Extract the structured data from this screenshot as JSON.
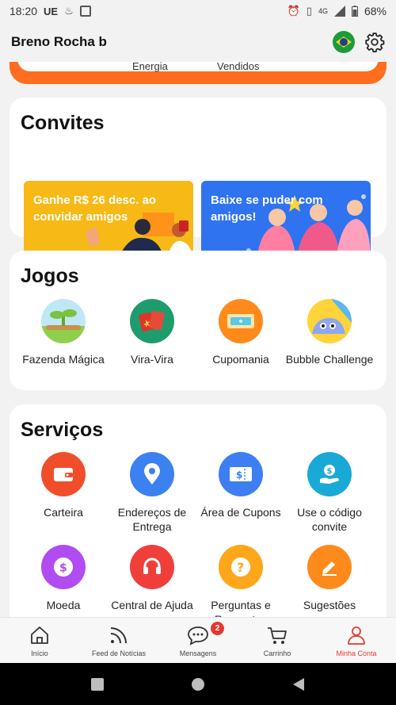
{
  "status_bar": {
    "time": "18:20",
    "carrier": "UE",
    "network": "4G",
    "battery": "68%"
  },
  "header": {
    "user_name": "Breno Rocha b"
  },
  "stats": {
    "labels": [
      "Energia",
      "Vendidos"
    ]
  },
  "invites": {
    "title": "Convites",
    "banners": [
      {
        "text": "Ganhe R$ 26 desc. ao convidar amigos"
      },
      {
        "text": "Baixe se puder com amigos!"
      }
    ]
  },
  "games": {
    "title": "Jogos",
    "items": [
      {
        "label": "Fazenda Mágica",
        "icon": "farm-icon"
      },
      {
        "label": "Vira-Vira",
        "icon": "cards-icon"
      },
      {
        "label": "Cupomania",
        "icon": "coupon-ticket-icon"
      },
      {
        "label": "Bubble Challenge",
        "icon": "bubble-icon"
      }
    ]
  },
  "services": {
    "title": "Serviços",
    "items": [
      {
        "label": "Carteira",
        "icon": "wallet-icon"
      },
      {
        "label": "Endereços de Entrega",
        "icon": "location-pin-icon"
      },
      {
        "label": "Área de Cupons",
        "icon": "coupon-icon"
      },
      {
        "label": "Use o código convite",
        "icon": "hand-coin-icon"
      },
      {
        "label": "Moeda",
        "icon": "coin-icon"
      },
      {
        "label": "Central de Ajuda",
        "icon": "headset-icon"
      },
      {
        "label": "Perguntas e Respostas",
        "icon": "question-icon"
      },
      {
        "label": "Sugestões",
        "icon": "pencil-icon"
      }
    ]
  },
  "bottom_nav": {
    "items": [
      {
        "label": "Início",
        "icon": "home-icon"
      },
      {
        "label": "Feed de Notícias",
        "icon": "feed-icon"
      },
      {
        "label": "Mensagens",
        "icon": "chat-icon",
        "badge": "2"
      },
      {
        "label": "Carrinho",
        "icon": "cart-icon"
      },
      {
        "label": "Minha Conta",
        "icon": "user-icon",
        "active": true
      }
    ]
  },
  "colors": {
    "accent": "#e23a2e",
    "orange": "#ff6d1f",
    "yellow": "#f7b916",
    "blue": "#2f73f0"
  }
}
